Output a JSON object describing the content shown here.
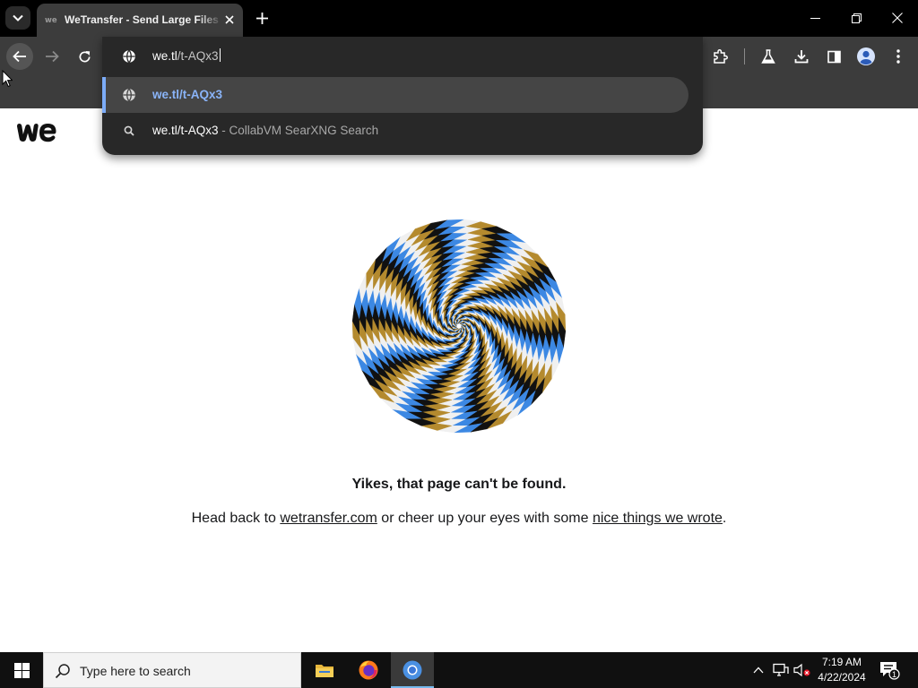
{
  "browser": {
    "tab": {
      "title": "WeTransfer - Send Large Files & Share Photos Online"
    },
    "omnibox": {
      "input_prefix": "we.tl",
      "input_suffix": "/t-AQx3",
      "suggestions": [
        {
          "text": "we.tl/t-AQx3",
          "icon": "globe-icon"
        },
        {
          "text": "we.tl/t-AQx3",
          "description": " - CollabVM SearXNG Search",
          "icon": "search-icon"
        }
      ]
    }
  },
  "page": {
    "error_title": "Yikes, that page can't be found.",
    "sub_before": "Head back to ",
    "link_home": "wetransfer.com",
    "sub_middle": " or cheer up your eyes with some ",
    "link_nice": "nice things we wrote",
    "sub_after": ".",
    "spiral_colors": [
      "#111111",
      "#3c88e3",
      "#f0f0f0",
      "#b48a2e"
    ]
  },
  "taskbar": {
    "search_placeholder": "Type here to search",
    "time": "7:19 AM",
    "date": "4/22/2024",
    "notification_count": "1"
  }
}
